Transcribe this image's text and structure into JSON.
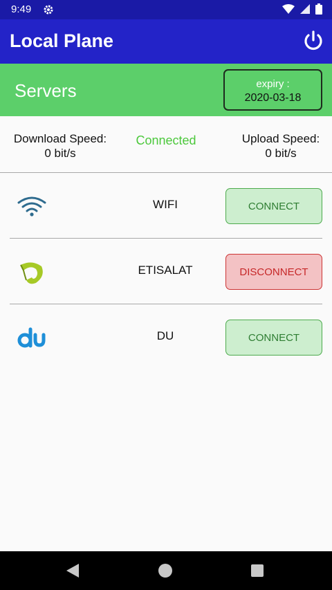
{
  "status_bar": {
    "time": "9:49"
  },
  "app_bar": {
    "title": "Local Plane"
  },
  "servers": {
    "title": "Servers",
    "expiry_label": "expiry :",
    "expiry_date": "2020-03-18"
  },
  "speed": {
    "download_label": "Download Speed:",
    "download_value": "0 bit/s",
    "status": "Connected",
    "upload_label": "Upload Speed:",
    "upload_value": "0 bit/s"
  },
  "networks": [
    {
      "name": "WIFI",
      "icon": "wifi-icon",
      "button": "CONNECT"
    },
    {
      "name": "ETISALAT",
      "icon": "etisalat-logo-icon",
      "button": "DISCONNECT"
    },
    {
      "name": "DU",
      "icon": "du-logo-icon",
      "button": "CONNECT"
    }
  ],
  "colors": {
    "app_bar": "#2323c8",
    "servers_bar": "#5ccf6a",
    "connected_text": "#4cc83c",
    "connect_button": "#cdeecf",
    "disconnect_button": "#f3c2c4"
  }
}
